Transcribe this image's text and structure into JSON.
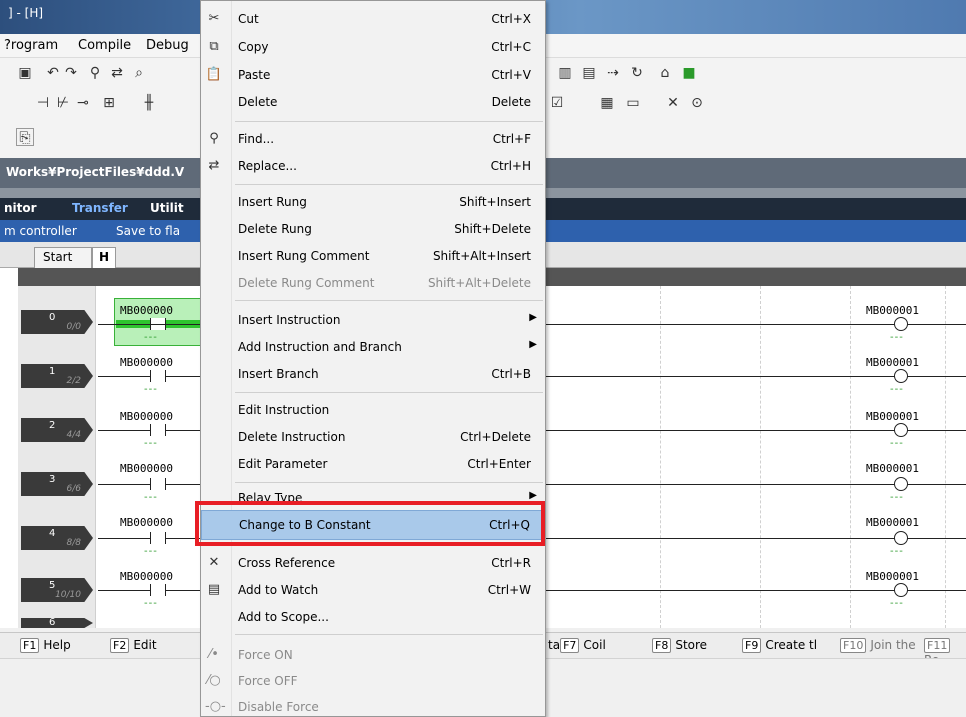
{
  "window": {
    "title": "] - [H]"
  },
  "menubar": {
    "items": [
      "?rogram",
      "Compile",
      "Debug"
    ]
  },
  "path": {
    "text": "Works¥ProjectFiles¥ddd.V"
  },
  "modebar": {
    "items": [
      "nitor",
      "Transfer",
      "Utilit"
    ]
  },
  "funcbar": {
    "items": [
      "m controller",
      "Save to fla"
    ]
  },
  "tabs": {
    "start": "Start",
    "h": "H"
  },
  "ladder": {
    "contact_label": "MB000000",
    "coil_label": "MB000001",
    "dash": "---",
    "rungs": [
      {
        "num": "0",
        "step": "0/0"
      },
      {
        "num": "1",
        "step": "2/2"
      },
      {
        "num": "2",
        "step": "4/4"
      },
      {
        "num": "3",
        "step": "6/6"
      },
      {
        "num": "4",
        "step": "8/8"
      },
      {
        "num": "5",
        "step": "10/10"
      },
      {
        "num": "6",
        "step": ""
      }
    ]
  },
  "fkeys": {
    "f1": {
      "key": "F1",
      "label": "Help"
    },
    "f2": {
      "key": "F2",
      "label": "Edit"
    },
    "f7": {
      "key": "F7",
      "label": "Coil",
      "prefix": "ta"
    },
    "f8": {
      "key": "F8",
      "label": "Store"
    },
    "f9": {
      "key": "F9",
      "label": "Create tl"
    },
    "f10": {
      "key": "F10",
      "label": "Join the"
    },
    "f11": {
      "key": "F11",
      "label": "Re"
    }
  },
  "context_menu": {
    "cut": {
      "label": "Cut",
      "key": "Ctrl+X"
    },
    "copy": {
      "label": "Copy",
      "key": "Ctrl+C"
    },
    "paste": {
      "label": "Paste",
      "key": "Ctrl+V"
    },
    "delete": {
      "label": "Delete",
      "key": "Delete"
    },
    "find": {
      "label": "Find...",
      "key": "Ctrl+F"
    },
    "replace": {
      "label": "Replace...",
      "key": "Ctrl+H"
    },
    "insert_rung": {
      "label": "Insert Rung",
      "key": "Shift+Insert"
    },
    "delete_rung": {
      "label": "Delete Rung",
      "key": "Shift+Delete"
    },
    "insert_rung_comment": {
      "label": "Insert Rung Comment",
      "key": "Shift+Alt+Insert"
    },
    "delete_rung_comment": {
      "label": "Delete Rung Comment",
      "key": "Shift+Alt+Delete"
    },
    "insert_instruction": {
      "label": "Insert Instruction"
    },
    "add_instruction_branch": {
      "label": "Add Instruction and Branch"
    },
    "insert_branch": {
      "label": "Insert Branch",
      "key": "Ctrl+B"
    },
    "edit_instruction": {
      "label": "Edit Instruction"
    },
    "delete_instruction": {
      "label": "Delete Instruction",
      "key": "Ctrl+Delete"
    },
    "edit_parameter": {
      "label": "Edit Parameter",
      "key": "Ctrl+Enter"
    },
    "relay_type": {
      "label": "Relay Type"
    },
    "change_b_constant": {
      "label": "Change to B Constant",
      "key": "Ctrl+Q"
    },
    "cross_reference": {
      "label": "Cross Reference",
      "key": "Ctrl+R"
    },
    "add_to_watch": {
      "label": "Add to Watch",
      "key": "Ctrl+W"
    },
    "add_to_scope": {
      "label": "Add to Scope..."
    },
    "force_on": {
      "label": "Force ON"
    },
    "force_off": {
      "label": "Force OFF"
    },
    "disable_force": {
      "label": "Disable Force"
    }
  }
}
